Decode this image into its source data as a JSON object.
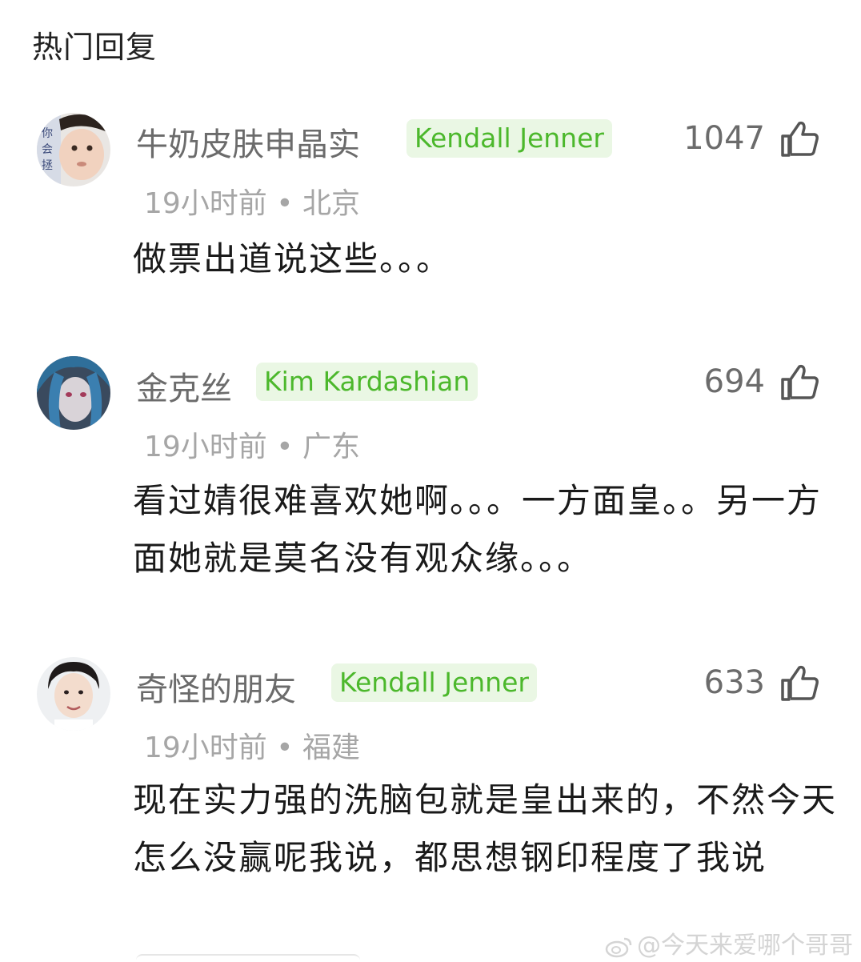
{
  "section_title": "热门回复",
  "comments": [
    {
      "name": "牛奶皮肤申晶实",
      "badge": "Kendall Jenner",
      "likes": "1047",
      "time": "19小时前",
      "location": "北京",
      "text": "做票出道说这些。。。"
    },
    {
      "name": "金克丝",
      "badge": "Kim Kardashian",
      "likes": "694",
      "time": "19小时前",
      "location": "广东",
      "text": "看过婧很难喜欢她啊。。。一方面皇。。另一方面她就是莫名没有观众缘。。。"
    },
    {
      "name": "奇怪的朋友",
      "badge": "Kendall Jenner",
      "likes": "633",
      "time": "19小时前",
      "location": "福建",
      "text": "现在实力强的洗脑包就是皇出来的，不然今天怎么没赢呢我说，都思想钢印程度了我说"
    }
  ],
  "watermark": "@今天来爱哪个哥哥",
  "colors": {
    "badge_bg": "#eaf7e4",
    "badge_text": "#4cb82c",
    "meta": "#a6a6a6"
  },
  "icons": {
    "like": "thumbs-up-icon",
    "watermark": "weibo-logo-icon"
  }
}
